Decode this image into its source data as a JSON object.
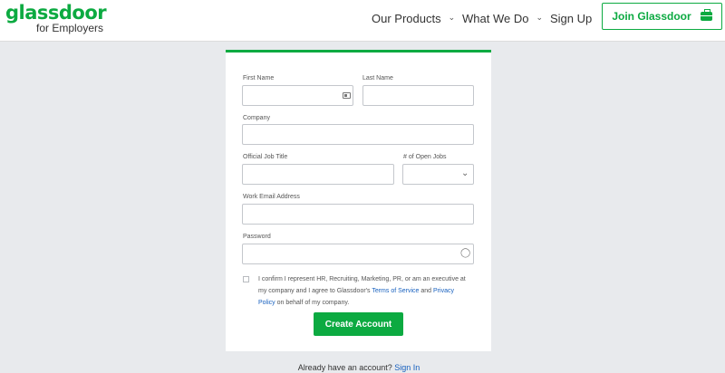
{
  "header": {
    "logo_main": "glassdoor",
    "logo_sub": "for Employers",
    "nav": [
      {
        "label": "Our Products",
        "has_dropdown": true
      },
      {
        "label": "What We Do",
        "has_dropdown": true
      },
      {
        "label": "Sign Up",
        "has_dropdown": false
      }
    ],
    "join_label": "Join Glassdoor"
  },
  "form": {
    "first_name": {
      "label": "First Name",
      "value": ""
    },
    "last_name": {
      "label": "Last Name",
      "value": ""
    },
    "company": {
      "label": "Company",
      "value": ""
    },
    "job_title": {
      "label": "Official Job Title",
      "value": ""
    },
    "open_jobs": {
      "label": "# of Open Jobs",
      "value": ""
    },
    "email": {
      "label": "Work Email Address",
      "value": ""
    },
    "password": {
      "label": "Password",
      "value": ""
    },
    "consent": {
      "checked": false,
      "text_before": "I confirm I represent HR, Recruiting, Marketing, PR, or am an executive at my company and I agree to Glassdoor's ",
      "terms_link": "Terms of Service",
      "text_middle": " and ",
      "privacy_link": "Privacy Policy",
      "text_after": " on behalf of my company."
    },
    "submit_label": "Create Account"
  },
  "footer": {
    "prompt": "Already have an account?",
    "signin_link": "Sign In"
  },
  "colors": {
    "brand_green": "#0caa41",
    "link_blue": "#1861bf",
    "page_bg": "#e8eaed"
  }
}
